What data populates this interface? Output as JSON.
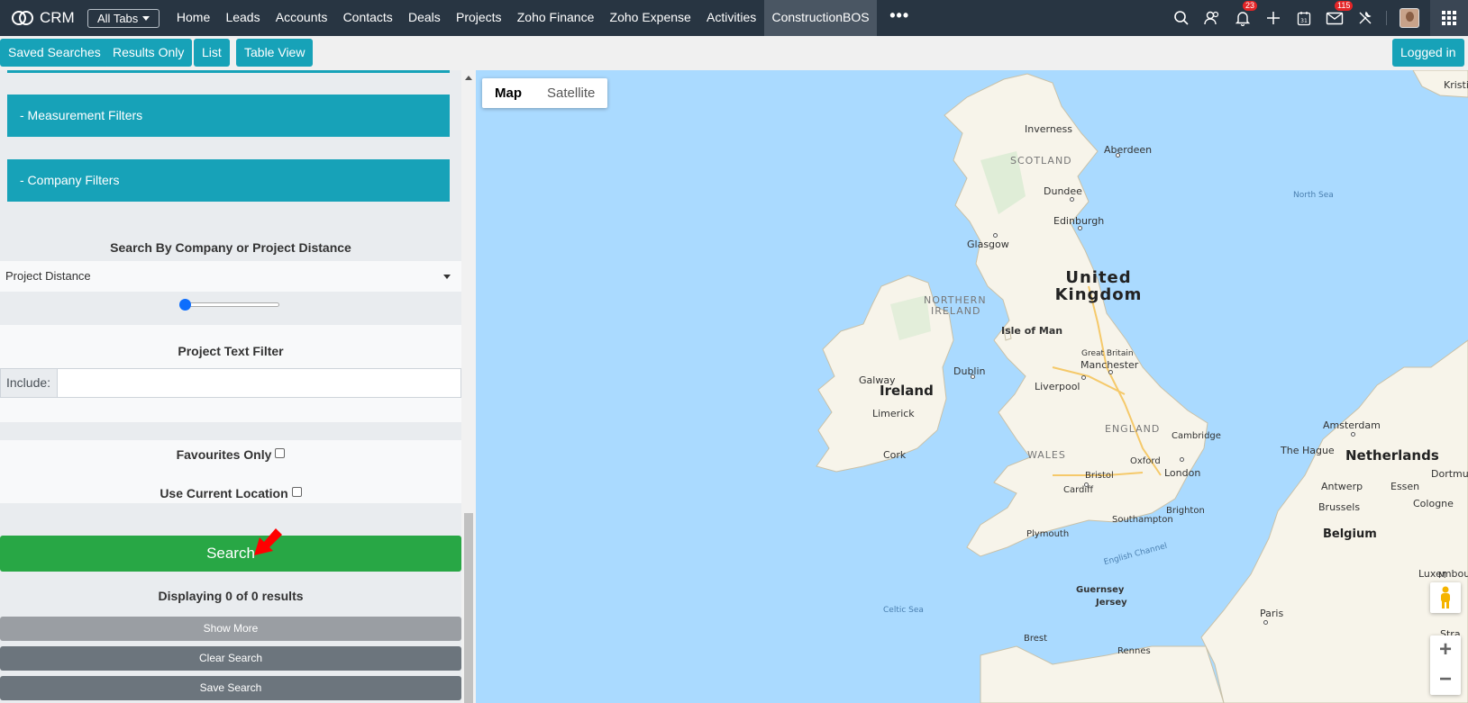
{
  "nav": {
    "app_name": "CRM",
    "all_tabs": "All Tabs",
    "tabs": [
      "Home",
      "Leads",
      "Accounts",
      "Contacts",
      "Deals",
      "Projects",
      "Zoho Finance",
      "Zoho Expense",
      "Activities",
      "ConstructionBOS"
    ],
    "active_tab": "ConstructionBOS",
    "more": "•••",
    "notifications_badge": "23",
    "mail_badge": "115",
    "icons": [
      "search-icon",
      "contacts-icon",
      "bell-icon",
      "plus-icon",
      "calendar-icon",
      "mail-icon",
      "tools-icon",
      "avatar",
      "apps-grid-icon"
    ]
  },
  "toolbar": {
    "saved_searches": "Saved Searches",
    "results_only": "Results Only",
    "list": "List",
    "table_view": "Table View",
    "logged_in": "Logged in"
  },
  "left_panel": {
    "measurement_filters": "- Measurement Filters",
    "company_filters": "- Company Filters",
    "distance_heading": "Search By Company or Project Distance",
    "distance_select": "Project Distance",
    "distance_slider_value": 0,
    "text_filter_heading": "Project Text Filter",
    "include_label": "Include:",
    "include_value": "",
    "favourites_only": "Favourites Only",
    "favourites_checked": false,
    "use_current_location": "Use Current Location",
    "current_location_checked": false,
    "search_button": "Search",
    "results_text": "Displaying 0 of 0 results",
    "show_more": "Show More",
    "clear_search": "Clear Search",
    "save_search": "Save Search"
  },
  "map": {
    "map_type_map": "Map",
    "map_type_satellite": "Satellite",
    "zoom_in": "+",
    "zoom_out": "−",
    "labels": {
      "kristiansand": "Kristia",
      "inverness": "Inverness",
      "aberdeen": "Aberdeen",
      "scotland": "SCOTLAND",
      "dundee": "Dundee",
      "north_sea": "North Sea",
      "edinburgh": "Edinburgh",
      "glasgow": "Glasgow",
      "united": "United",
      "kingdom": "Kingdom",
      "northern": "NORTHERN",
      "ireland_region": "IRELAND",
      "isle_of_man": "Isle of Man",
      "great_britain": "Great Britain",
      "manchester": "Manchester",
      "galway": "Galway",
      "dublin": "Dublin",
      "ireland": "Ireland",
      "liverpool": "Liverpool",
      "limerick": "Limerick",
      "england": "ENGLAND",
      "amsterdam": "Amsterdam",
      "cambridge": "Cambridge",
      "the_hague": "The Hague",
      "netherlands": "Netherlands",
      "wales": "WALES",
      "cork": "Cork",
      "oxford": "Oxford",
      "london": "London",
      "dortmund": "Dortmun",
      "antwerp": "Antwerp",
      "essen": "Essen",
      "bristol": "Bristol",
      "cardiff": "Cardiff",
      "cologne": "Cologne",
      "brussels": "Brussels",
      "southampton": "Southampton",
      "brighton": "Brighton",
      "belgium": "Belgium",
      "plymouth": "Plymouth",
      "english_channel": "English Channel",
      "luxembourg": "Luxembour",
      "guernsey": "Guernsey",
      "jersey": "Jersey",
      "celtic_sea": "Celtic Sea",
      "paris": "Paris",
      "brest": "Brest",
      "rennes": "Rennes",
      "strasbourg": "Stra",
      "m_cut": "M"
    }
  }
}
